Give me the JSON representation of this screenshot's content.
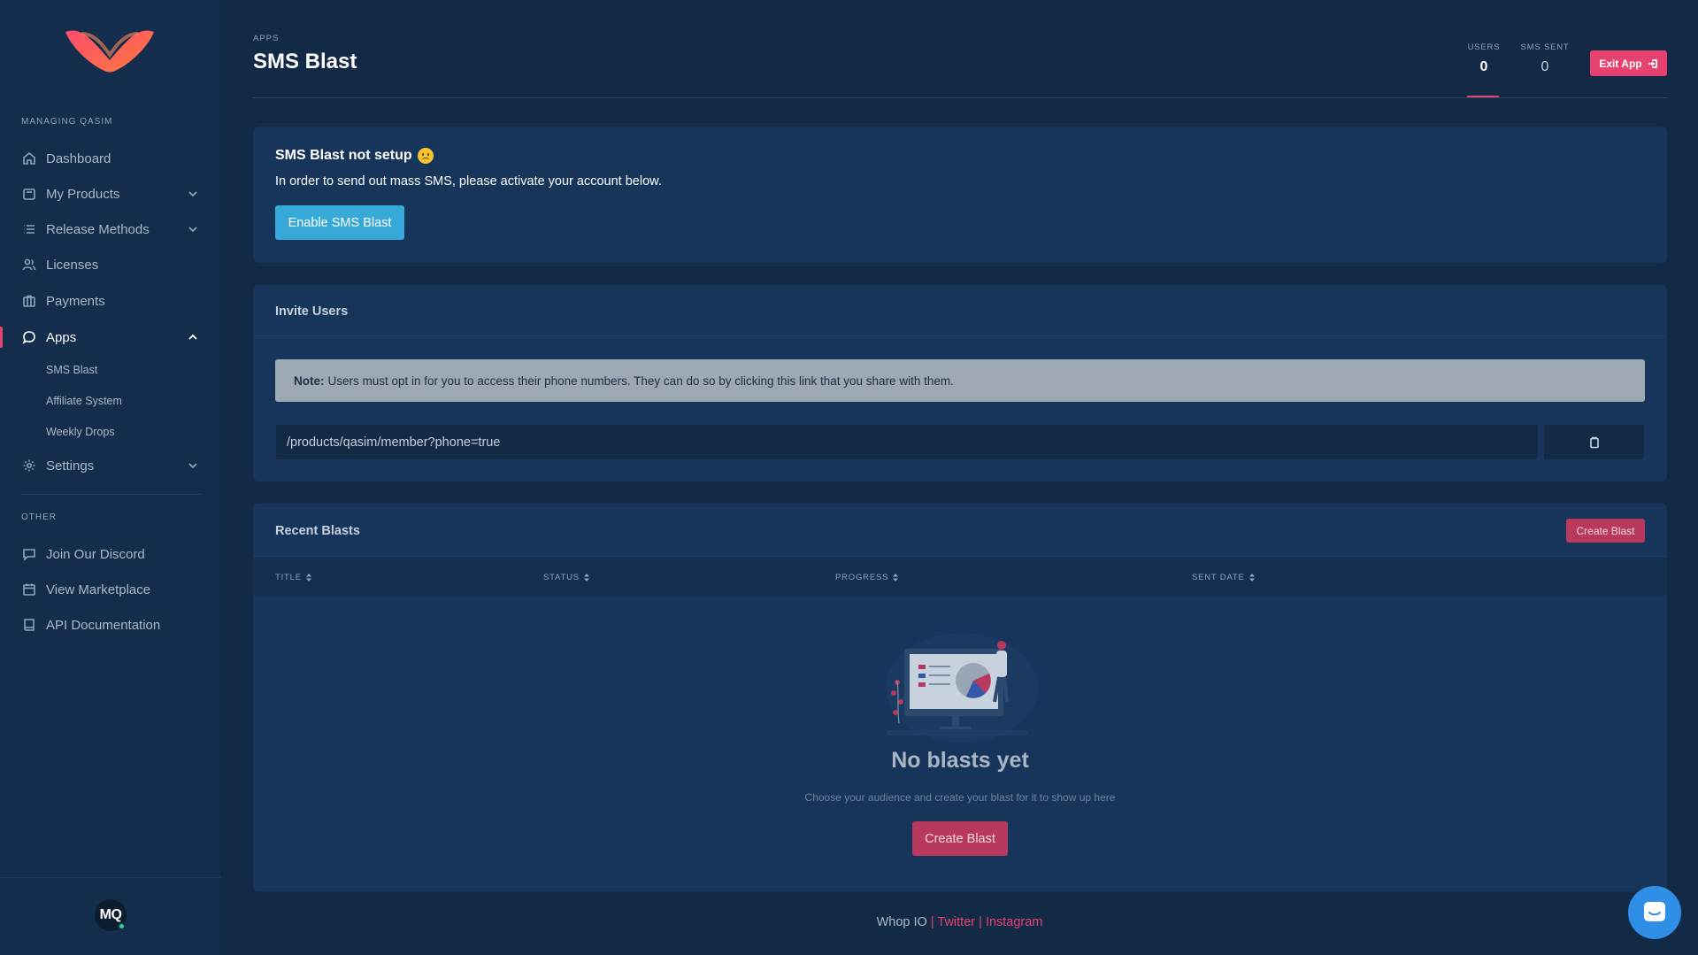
{
  "sidebar": {
    "managing_label": "MANAGING QASIM",
    "nav": [
      {
        "label": "Dashboard",
        "icon": "home-icon"
      },
      {
        "label": "My Products",
        "icon": "box-icon"
      },
      {
        "label": "Release Methods",
        "icon": "list-icon"
      },
      {
        "label": "Licenses",
        "icon": "users-icon"
      },
      {
        "label": "Payments",
        "icon": "briefcase-icon"
      },
      {
        "label": "Apps",
        "icon": "chat-icon"
      },
      {
        "label": "Settings",
        "icon": "gear-icon"
      }
    ],
    "apps_sub": [
      "SMS Blast",
      "Affiliate System",
      "Weekly Drops"
    ],
    "other_label": "OTHER",
    "other": [
      {
        "label": "Join Our Discord",
        "icon": "message-icon"
      },
      {
        "label": "View Marketplace",
        "icon": "calendar-icon"
      },
      {
        "label": "API Documentation",
        "icon": "book-icon"
      }
    ],
    "avatar_initials": "MQ"
  },
  "header": {
    "breadcrumb": "APPS",
    "title": "SMS Blast",
    "stats": {
      "users_label": "USERS",
      "users_value": "0",
      "sms_label": "SMS SENT",
      "sms_value": "0"
    },
    "exit_label": "Exit App"
  },
  "setup": {
    "title": "SMS Blast not setup",
    "description": "In order to send out mass SMS, please activate your account below.",
    "button": "Enable SMS Blast"
  },
  "invite": {
    "title": "Invite Users",
    "note_label": "Note:",
    "note_text": "Users must opt in for you to access their phone numbers. They can do so by clicking this link that you share with them.",
    "link_value": "/products/qasim/member?phone=true"
  },
  "blasts": {
    "title": "Recent Blasts",
    "create_label": "Create Blast",
    "columns": [
      "TITLE",
      "STATUS",
      "PROGRESS",
      "SENT DATE"
    ],
    "empty_title": "No blasts yet",
    "empty_subtitle": "Choose your audience and create your blast for it to show up here",
    "empty_button": "Create Blast"
  },
  "footer": {
    "brand": "Whop IO",
    "sep": "|",
    "twitter": "Twitter",
    "instagram": "Instagram"
  },
  "colors": {
    "background": "#132a46",
    "sidebar": "#142d4c",
    "accent": "#e6416f",
    "primary_button": "#37a9d8",
    "chat": "#2f8ee6"
  }
}
